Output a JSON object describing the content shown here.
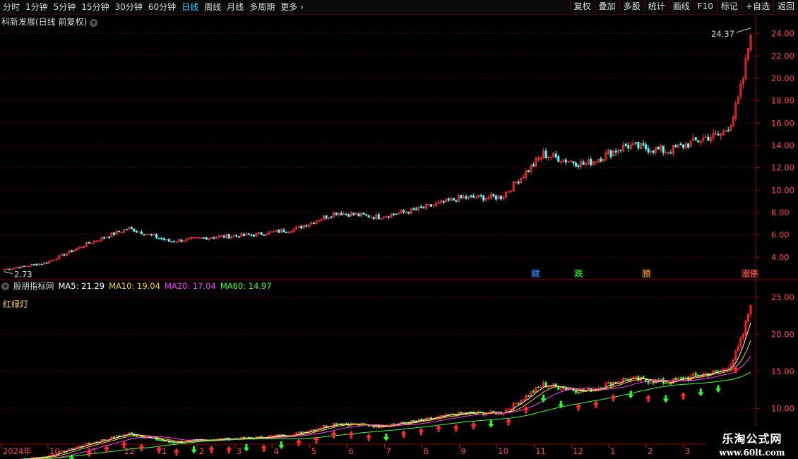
{
  "toolbar": {
    "periods": [
      "分时",
      "1分钟",
      "5分钟",
      "15分钟",
      "30分钟",
      "60分钟",
      "日线",
      "周线",
      "月线",
      "多周期",
      "更多"
    ],
    "active_period": "日线",
    "more_arrow": "›",
    "tools": [
      "复权",
      "叠加",
      "多股",
      "统计",
      "画线",
      "F10",
      "标记",
      "+自选",
      "返回"
    ]
  },
  "main_panel": {
    "title": "科新发展(日线 前复权)",
    "max_label": "24.37",
    "min_label": "2.73",
    "y_ticks": [
      "24.00",
      "22.00",
      "20.00",
      "18.00",
      "16.00",
      "14.00",
      "12.00",
      "10.00",
      "8.00",
      "6.00",
      "4.00"
    ],
    "events": [
      {
        "label": "财",
        "color": "#3aa0ff",
        "bg": "#10204a"
      },
      {
        "label": "跌",
        "color": "#3cff3c",
        "bg": "#0b2a0b"
      },
      {
        "label": "预",
        "color": "#ffa040",
        "bg": "#3a2000"
      },
      {
        "label": "涨停",
        "color": "#ff6a6a",
        "bg": "#4a1010"
      }
    ]
  },
  "indicator_panel": {
    "title": "股朋指标网",
    "ma5": "MA5: 21.29",
    "ma10": "MA10: 19.04",
    "ma20": "MA20: 17.04",
    "ma60": "MA60: 14.97",
    "name": "红绿灯",
    "y_ticks": [
      "25.00",
      "20.00",
      "15.00",
      "10.00"
    ],
    "colors": {
      "ma5": "#ffffff",
      "ma10": "#ffd400",
      "ma20": "#ff3cff",
      "ma60": "#3cff3c"
    }
  },
  "x_axis": {
    "labels": [
      "2024年",
      "10",
      "11",
      "12",
      "1",
      "2",
      "3",
      "4",
      "5",
      "6",
      "7",
      "8",
      "9",
      "10",
      "11",
      "12",
      "1",
      "2",
      "3"
    ]
  },
  "watermark": {
    "line1": "乐淘公式网",
    "line2": "www.60lt.com"
  },
  "chart_data": {
    "type": "candlestick",
    "title": "科新发展(日线 前复权)",
    "ylim": [
      2.5,
      24.8
    ],
    "price_points": [
      {
        "date": "2024-09",
        "close": 2.9
      },
      {
        "date": "2024-10",
        "close": 3.5
      },
      {
        "date": "2024-11",
        "close": 5.2
      },
      {
        "date": "2024-12",
        "close": 6.6
      },
      {
        "date": "2025-01",
        "close": 5.4
      },
      {
        "date": "2025-02",
        "close": 5.8
      },
      {
        "date": "2025-03",
        "close": 6.0
      },
      {
        "date": "2025-04",
        "close": 6.5
      },
      {
        "date": "2025-05",
        "close": 8.0
      },
      {
        "date": "2025-06",
        "close": 7.6
      },
      {
        "date": "2025-07",
        "close": 8.3
      },
      {
        "date": "2025-08",
        "close": 9.3
      },
      {
        "date": "2025-09",
        "close": 9.4
      },
      {
        "date": "2025-10",
        "close": 13.2
      },
      {
        "date": "2025-11",
        "close": 12.3
      },
      {
        "date": "2025-12",
        "close": 14.0
      },
      {
        "date": "2026-01",
        "close": 13.5
      },
      {
        "date": "2026-02",
        "close": 14.8
      },
      {
        "date": "2026-03",
        "close": 24.37
      }
    ],
    "annotations": {
      "high": 24.37,
      "low": 2.73
    }
  }
}
